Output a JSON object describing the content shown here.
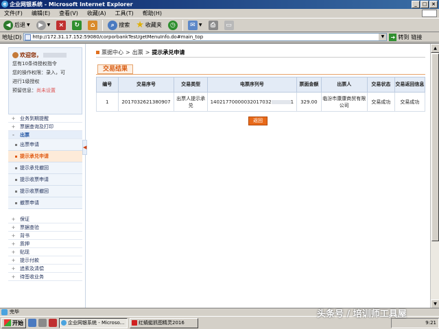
{
  "window": {
    "title": "企业网银系统 - Microsoft Internet Explorer",
    "controls": [
      "_",
      "□",
      "×"
    ]
  },
  "menu": [
    "文件(F)",
    "编辑(E)",
    "查看(V)",
    "收藏(A)",
    "工具(T)",
    "帮助(H)"
  ],
  "toolbar": {
    "back_label": "后退",
    "search_label": "搜索",
    "favorites_label": "收藏夹"
  },
  "address": {
    "label": "地址(D)",
    "url": "http://172.31.17.152:59080/corporbankTest/getMenuInfo.do#main_top",
    "go_label": "转到",
    "links_label": "链接"
  },
  "user_panel": {
    "welcome": "欢迎您，",
    "line1": "您有10条待授权指令",
    "line2": "您的操作权限：录入，可",
    "line3": "进行1级授权",
    "warning_label": "预留信息：",
    "warning_value": "尚未设置"
  },
  "nav": {
    "before": [
      {
        "label": "业务到期提醒",
        "toggle": "+"
      },
      {
        "label": "票据查询及打印",
        "toggle": "+"
      }
    ],
    "open_section": {
      "label": "出票",
      "toggle": "-"
    },
    "sub_items": [
      {
        "label": "出票申请",
        "active": false
      },
      {
        "label": "提示承兑申请",
        "active": true
      },
      {
        "label": "提示承兑撤回",
        "active": false
      },
      {
        "label": "提示收票申请",
        "active": false
      },
      {
        "label": "提示收票撤回",
        "active": false
      },
      {
        "label": "撤票申请",
        "active": false
      }
    ],
    "after": [
      {
        "label": "保证",
        "toggle": "+"
      },
      {
        "label": "票据查验",
        "toggle": "+"
      },
      {
        "label": "背书",
        "toggle": "+"
      },
      {
        "label": "质押",
        "toggle": "+"
      },
      {
        "label": "贴现",
        "toggle": "+"
      },
      {
        "label": "提示付款",
        "toggle": "+"
      },
      {
        "label": "追索及清偿",
        "toggle": "+"
      },
      {
        "label": "待签收业务",
        "toggle": "+"
      }
    ]
  },
  "breadcrumb": {
    "level1": "票据中心",
    "level2": "出票",
    "current": "提示承兑申请",
    "separator": ">"
  },
  "result_tab": "交易结果",
  "table": {
    "headers": [
      "编号",
      "交易序号",
      "交易类型",
      "电票序列号",
      "票面金额",
      "出票人",
      "交易状态",
      "交易返回信息"
    ],
    "rows": [
      {
        "id": "1",
        "seq": "2017032621380907",
        "type": "出票人提示承兑",
        "serial": "14021770000032017032",
        "serial_tail": "1",
        "amount": "329.00",
        "drawer": "临汾市康康商贸有限公司",
        "status": "交易成功",
        "message": "交易成功"
      }
    ]
  },
  "return_button": "返回",
  "statusbar": {
    "text": "完毕"
  },
  "taskbar": {
    "start_label": "开始",
    "tasks": [
      {
        "label": "企业网银系统 - Microso...",
        "active": true
      },
      {
        "label": "红蜻蜓抓图精灵2016",
        "active": false
      }
    ],
    "clock": "9:21"
  },
  "watermark": "头条号 / 培训师工具屋"
}
